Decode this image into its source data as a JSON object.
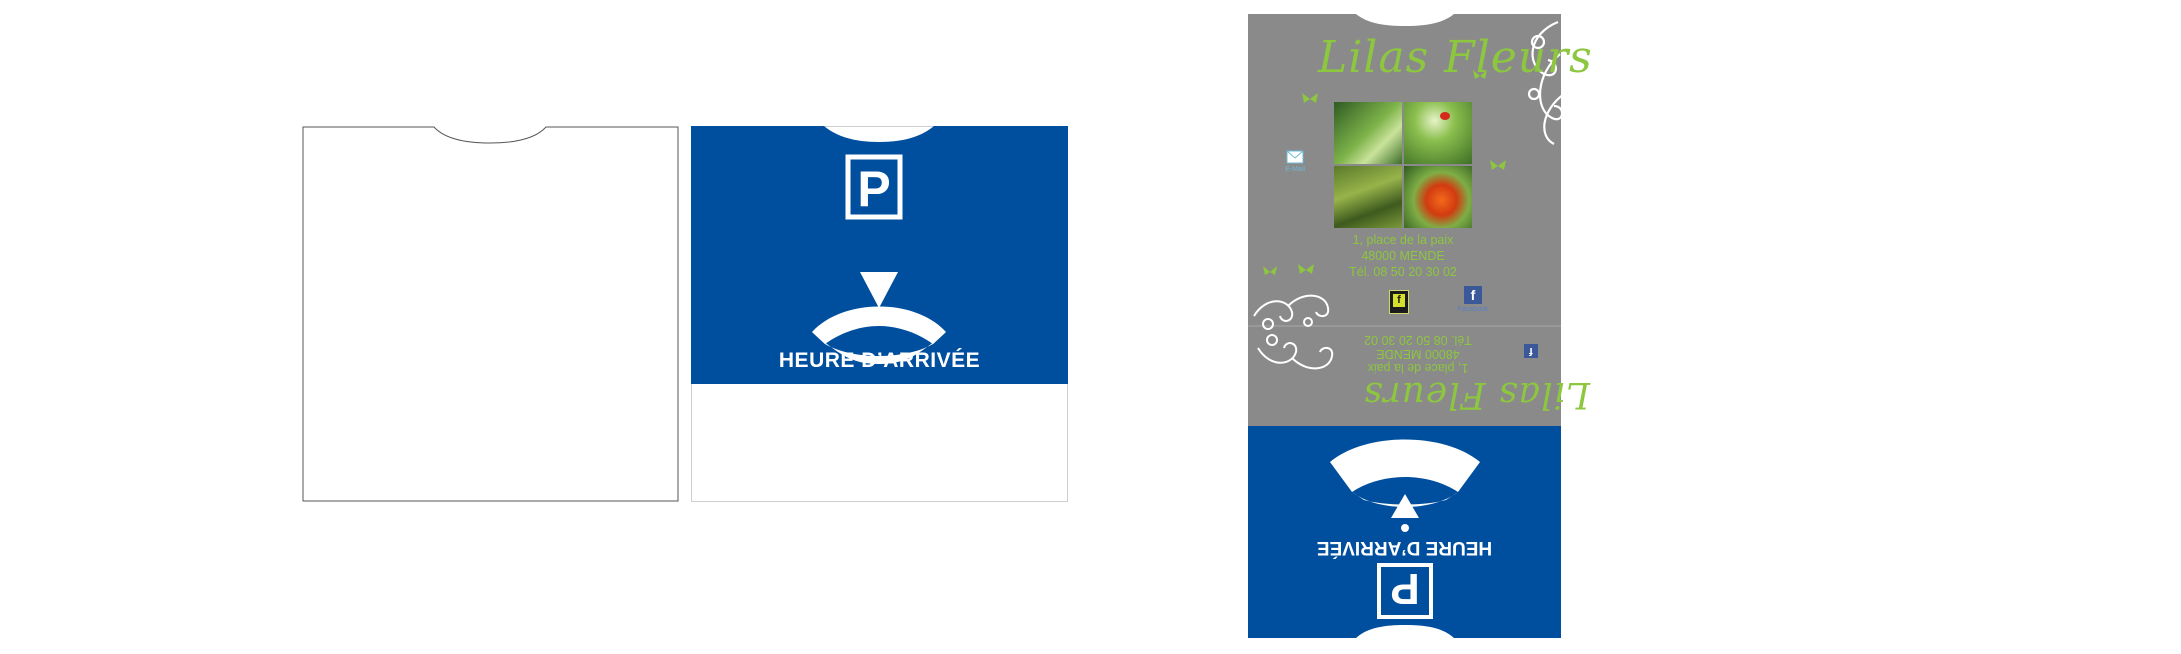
{
  "disc": {
    "p_letter": "P",
    "arrival_label": "HEURE D’ARRIVÉE",
    "blue": "#004f9f"
  },
  "sleeve": {
    "gray": "#8a8a8a",
    "accent_green": "#8dc63f",
    "brand": "Lilas Fleurs",
    "address_line1": "1, place de la paix",
    "address_line2": "48000 MENDE",
    "phone": "Tél. 08 50 20 30 02",
    "icons": {
      "email_label": "E-Mail",
      "facebook_label": "Facebook",
      "facebook_glyph": "f",
      "badge_glyph": "f"
    }
  }
}
